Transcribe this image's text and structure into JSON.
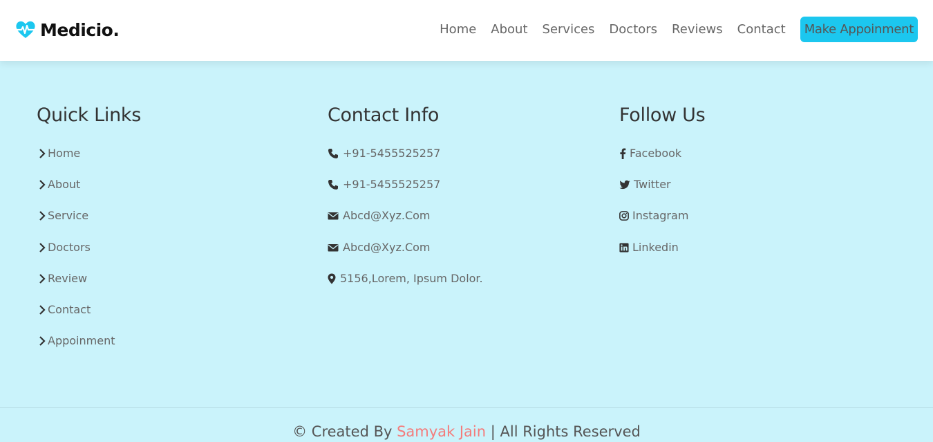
{
  "brand": {
    "name": "Medicio.",
    "accent_color": "#1cc7ef",
    "icon": "heartbeat-icon"
  },
  "nav": {
    "items": [
      "Home",
      "About",
      "Services",
      "Doctors",
      "Reviews",
      "Contact"
    ],
    "cta_label": "Make Appoinment"
  },
  "footer": {
    "quick_links": {
      "title": "Quick Links",
      "icon": "chevron-right-icon",
      "items": [
        "Home",
        "About",
        "Service",
        "Doctors",
        "Review",
        "Contact",
        "Appoinment"
      ]
    },
    "contact_info": {
      "title": "Contact Info",
      "items": [
        {
          "icon": "phone-icon",
          "text": "+91-5455525257"
        },
        {
          "icon": "phone-icon",
          "text": "+91-5455525257"
        },
        {
          "icon": "envelope-icon",
          "text": "Abcd@Xyz.Com"
        },
        {
          "icon": "envelope-icon",
          "text": "Abcd@Xyz.Com"
        },
        {
          "icon": "map-marker-icon",
          "text": "5156,Lorem, Ipsum Dolor."
        }
      ]
    },
    "follow_us": {
      "title": "Follow Us",
      "items": [
        {
          "icon": "facebook-icon",
          "text": "Facebook"
        },
        {
          "icon": "twitter-icon",
          "text": "Twitter"
        },
        {
          "icon": "instagram-icon",
          "text": "Instagram"
        },
        {
          "icon": "linkedin-icon",
          "text": "Linkedin"
        }
      ]
    },
    "credit": {
      "prefix": "© Created By ",
      "author": "Samyak Jain",
      "suffix": " | All Rights Reserved",
      "author_color": "#f47b7b"
    },
    "background_color": "#caf3fb"
  }
}
